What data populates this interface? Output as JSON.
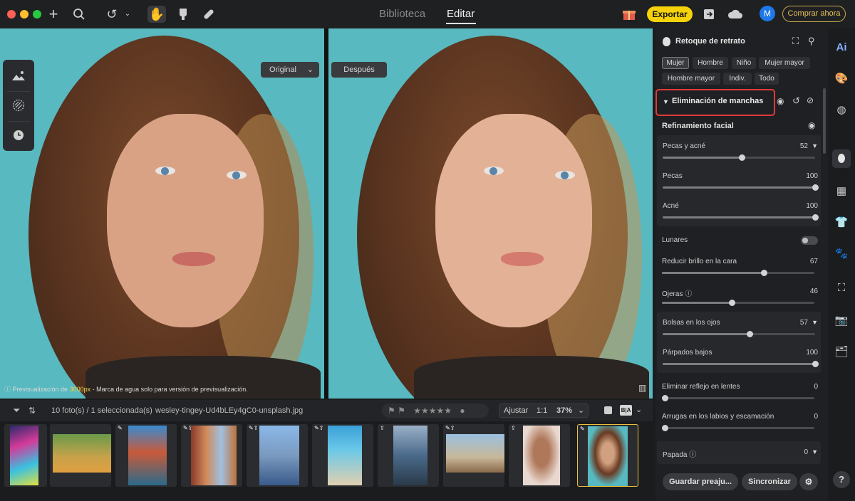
{
  "window": {
    "tabs": [
      "Biblioteca",
      "Editar"
    ],
    "active_tab": "Editar"
  },
  "toolbar": {
    "export_label": "Exportar",
    "buy_label": "Comprar ahora",
    "avatar_letter": "M"
  },
  "canvas": {
    "original_select": "Original",
    "after_label": "Después",
    "preview_note_prefix": "Previsualización de ",
    "preview_note_size": "3000px",
    "preview_note_suffix": " - Marca de agua solo para versión de previsualización."
  },
  "filmstrip_toolbar": {
    "count": "10 foto(s) / 1 seleccionada(s)",
    "filename": "wesley-tingey-Ud4bLEy4gC0-unsplash.jpg",
    "fit": "Ajustar",
    "one_to_one": "1:1",
    "zoom": "37%",
    "before_after": "B|A",
    "stars": "★★★★★"
  },
  "panel": {
    "title": "Retoque de retrato",
    "presets": [
      "Mujer",
      "Hombre",
      "Niño",
      "Mujer mayor",
      "Hombre mayor",
      "Indiv.",
      "Todo"
    ],
    "active_preset": "Mujer",
    "section_title": "Eliminación de manchas",
    "subsection_title": "Refinamiento facial",
    "sliders": {
      "pecas_acne": {
        "label": "Pecas y acné",
        "value": 52
      },
      "pecas": {
        "label": "Pecas",
        "value": 100
      },
      "acne": {
        "label": "Acné",
        "value": 100
      },
      "lunares": {
        "label": "Lunares",
        "on": false
      },
      "brillo": {
        "label": "Reducir brillo en la cara",
        "value": 67
      },
      "ojeras": {
        "label": "Ojeras",
        "value": 46
      },
      "bolsas": {
        "label": "Bolsas en los ojos",
        "value": 57
      },
      "parpados": {
        "label": "Párpados bajos",
        "value": 100
      },
      "reflejo": {
        "label": "Eliminar reflejo en lentes",
        "value": 0
      },
      "arrugas": {
        "label": "Arrugas en los labios y escamación",
        "value": 0
      },
      "papada": {
        "label": "Papada",
        "value": 0
      }
    },
    "save_preset": "Guardar preaju...",
    "sync": "Sincronizar"
  },
  "rail": {
    "ai_label": "Ai",
    "help": "?"
  },
  "colors": {
    "accent_yellow": "#f5d20a",
    "highlight_red": "#e03a3a",
    "photo_bg": "#58b9c0"
  }
}
